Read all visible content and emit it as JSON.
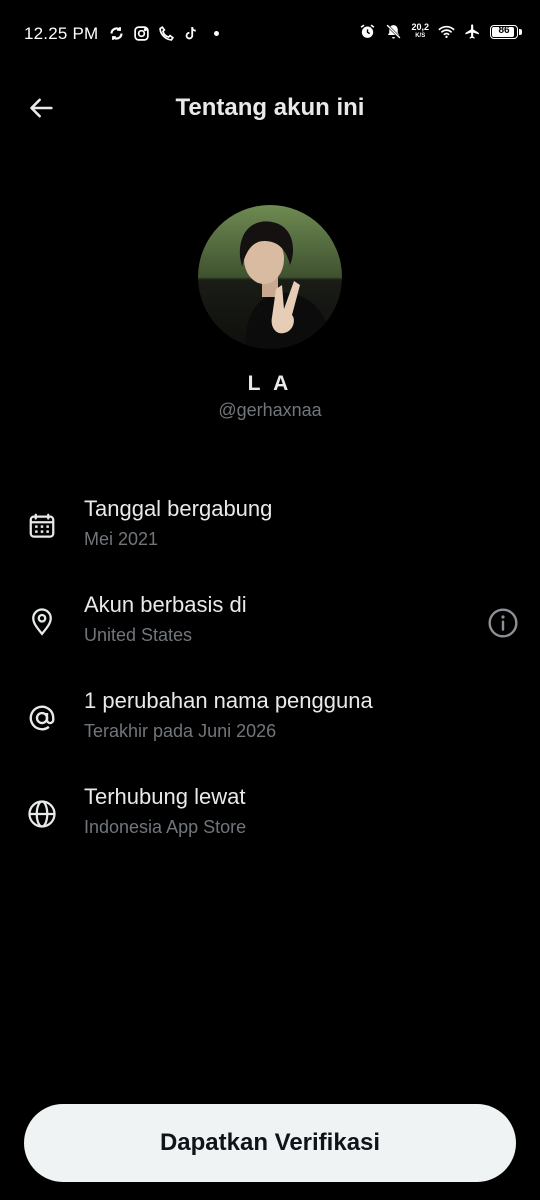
{
  "status_bar": {
    "time": "12.25 PM",
    "left_icons": [
      "sync-icon",
      "instagram-icon",
      "phone-icon",
      "tiktok-icon",
      "dot-icon"
    ],
    "right_icons": [
      "alarm-icon",
      "mute-icon",
      "wifi-icon",
      "airplane-icon"
    ],
    "net_speed_value": "20,2",
    "net_speed_unit": "K/S",
    "battery": "86"
  },
  "header": {
    "title": "Tentang akun ini",
    "back_icon": "arrow-left-icon"
  },
  "profile": {
    "display_name": "L A",
    "handle": "@gerhaxnaa"
  },
  "info_rows": [
    {
      "icon": "calendar-icon",
      "title": "Tanggal bergabung",
      "subtitle": "Mei 2021"
    },
    {
      "icon": "location-pin-icon",
      "title": "Akun berbasis di",
      "subtitle": "United States",
      "action_icon": "info-icon"
    },
    {
      "icon": "at-sign-icon",
      "title": "1 perubahan nama pengguna",
      "subtitle": "Terakhir pada Juni 2026"
    },
    {
      "icon": "globe-icon",
      "title": "Terhubung lewat",
      "subtitle": "Indonesia App Store"
    }
  ],
  "colors": {
    "background": "#000000",
    "primary_text": "#e7e9ea",
    "secondary_text": "#71767b",
    "button_bg": "#eff3f4",
    "button_text": "#0f1419"
  },
  "cta": {
    "label": "Dapatkan Verifikasi"
  }
}
